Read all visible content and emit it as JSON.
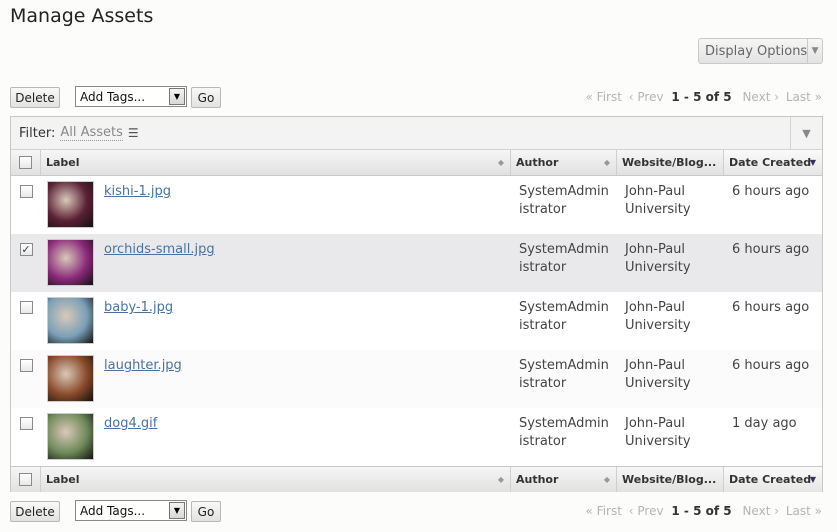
{
  "page": {
    "title": "Manage Assets"
  },
  "toolbar": {
    "display_options": "Display Options"
  },
  "actions": {
    "delete": "Delete",
    "tags_select": "Add Tags...",
    "go": "Go"
  },
  "pager": {
    "first": "« First",
    "prev": "‹ Prev",
    "range": "1 - 5 of 5",
    "next": "Next ›",
    "last": "Last »"
  },
  "filter": {
    "label": "Filter:",
    "value": "All Assets"
  },
  "columns": {
    "label": "Label",
    "author": "Author",
    "site": "Website/Blog...",
    "date": "Date Created"
  },
  "rows": [
    {
      "file": "kishi-1.jpg",
      "author": "SystemAdministrator",
      "site": "John-Paul University",
      "date": "6 hours ago",
      "checked": false,
      "thumb": "#5b2035"
    },
    {
      "file": "orchids-small.jpg",
      "author": "SystemAdministrator",
      "site": "John-Paul University",
      "date": "6 hours ago",
      "checked": true,
      "thumb": "#8a2a7a"
    },
    {
      "file": "baby-1.jpg",
      "author": "SystemAdministrator",
      "site": "John-Paul University",
      "date": "6 hours ago",
      "checked": false,
      "thumb": "#7aa0b8"
    },
    {
      "file": "laughter.jpg",
      "author": "SystemAdministrator",
      "site": "John-Paul University",
      "date": "6 hours ago",
      "checked": false,
      "thumb": "#8a4a2a"
    },
    {
      "file": "dog4.gif",
      "author": "SystemAdministrator",
      "site": "John-Paul University",
      "date": "1 day ago",
      "checked": false,
      "thumb": "#6f8a5a"
    }
  ],
  "icons": {
    "list": "list-icon",
    "sort": "sort-icon",
    "dropdown": "chevron-down-icon"
  }
}
